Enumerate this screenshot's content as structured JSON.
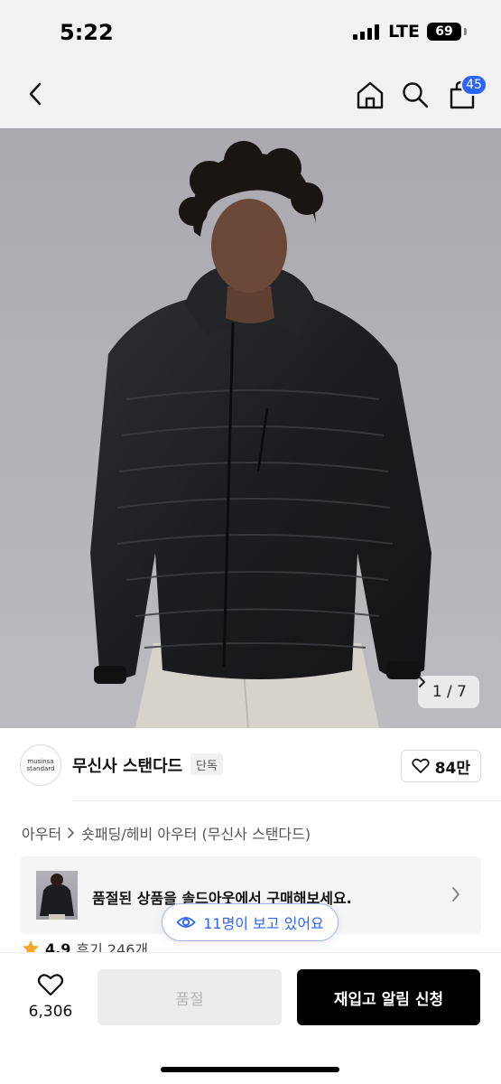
{
  "status": {
    "time": "5:22",
    "network": "LTE",
    "battery": "69"
  },
  "nav": {
    "cart_count": "45",
    "icons": [
      "chevron-left-icon",
      "home-icon",
      "search-icon",
      "cart-icon"
    ]
  },
  "gallery": {
    "counter": "1 / 7"
  },
  "brand": {
    "logo_line1": "musinsa",
    "logo_line2": "standard",
    "name": "무신사 스탠다드",
    "badge": "단독",
    "likes": "84만"
  },
  "breadcrumb": {
    "items": [
      "아우터",
      "숏패딩/헤비 아우터 (무신사 스탠다드)"
    ]
  },
  "soldout_banner": {
    "text": "품절된 상품을 솔드아웃에서 구매해보세요."
  },
  "viewers": {
    "text": "11명이 보고 있어요"
  },
  "rating": {
    "score": "4.9",
    "reviews": "후기 246개"
  },
  "bottom_bar": {
    "wish_count": "6,306",
    "soldout_label": "품절",
    "restock_label": "재입고 알림 신청"
  },
  "colors": {
    "accent": "#2c64f6",
    "star": "#f5a623",
    "primary_button": "#000000"
  }
}
